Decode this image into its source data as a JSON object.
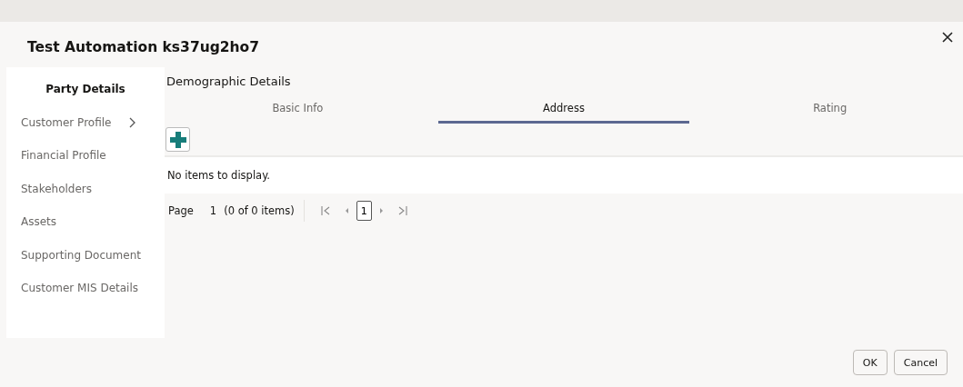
{
  "dialog": {
    "title": "Test Automation ks37ug2ho7"
  },
  "sidebar": {
    "items": [
      {
        "label": "Party Details",
        "selected": true,
        "expandable": false
      },
      {
        "label": "Customer Profile",
        "selected": false,
        "expandable": true
      },
      {
        "label": "Financial Profile",
        "selected": false,
        "expandable": false
      },
      {
        "label": "Stakeholders",
        "selected": false,
        "expandable": false
      },
      {
        "label": "Assets",
        "selected": false,
        "expandable": false
      },
      {
        "label": "Supporting Document",
        "selected": false,
        "expandable": false
      },
      {
        "label": "Customer MIS Details",
        "selected": false,
        "expandable": false
      }
    ]
  },
  "section_title": "Demographic Details",
  "tabs": [
    {
      "label": "Basic Info",
      "selected": false
    },
    {
      "label": "Address",
      "selected": true
    },
    {
      "label": "Rating",
      "selected": false
    }
  ],
  "table": {
    "empty_message": "No items to display."
  },
  "pagination": {
    "label": "Page",
    "page": "1",
    "summary": "(0 of 0 items)",
    "current_page": "1"
  },
  "buttons": [
    {
      "label": "OK"
    },
    {
      "label": "Cancel"
    }
  ]
}
